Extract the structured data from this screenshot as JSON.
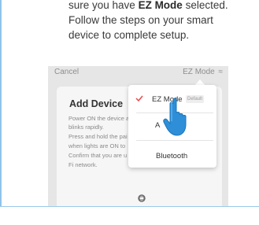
{
  "intro": {
    "line1_prefix": "sure you have ",
    "line1_bold": "EZ Mode",
    "line1_suffix": " selected.",
    "line2": "Follow the steps on your smart",
    "line3": "device to complete setup."
  },
  "phone": {
    "cancel_label": "Cancel",
    "mode_label": "EZ Mode",
    "mode_icon": "wifi-icon",
    "card": {
      "title": "Add Device",
      "steps": [
        "Power ON the device a",
        "blinks rapidly.",
        "Press and hold the pai",
        "when lights are ON to",
        "Confirm that you are u",
        "Fi network."
      ]
    }
  },
  "menu": {
    "items": [
      {
        "label": "EZ Mode",
        "badge": "Default",
        "selected": true
      },
      {
        "label": "A",
        "selected": false
      },
      {
        "label": "Bluetooth",
        "selected": false
      }
    ]
  },
  "colors": {
    "accent_rule": "#8fc3e8",
    "checkmark": "#e84a4a",
    "hand": "#2e8fd8"
  }
}
